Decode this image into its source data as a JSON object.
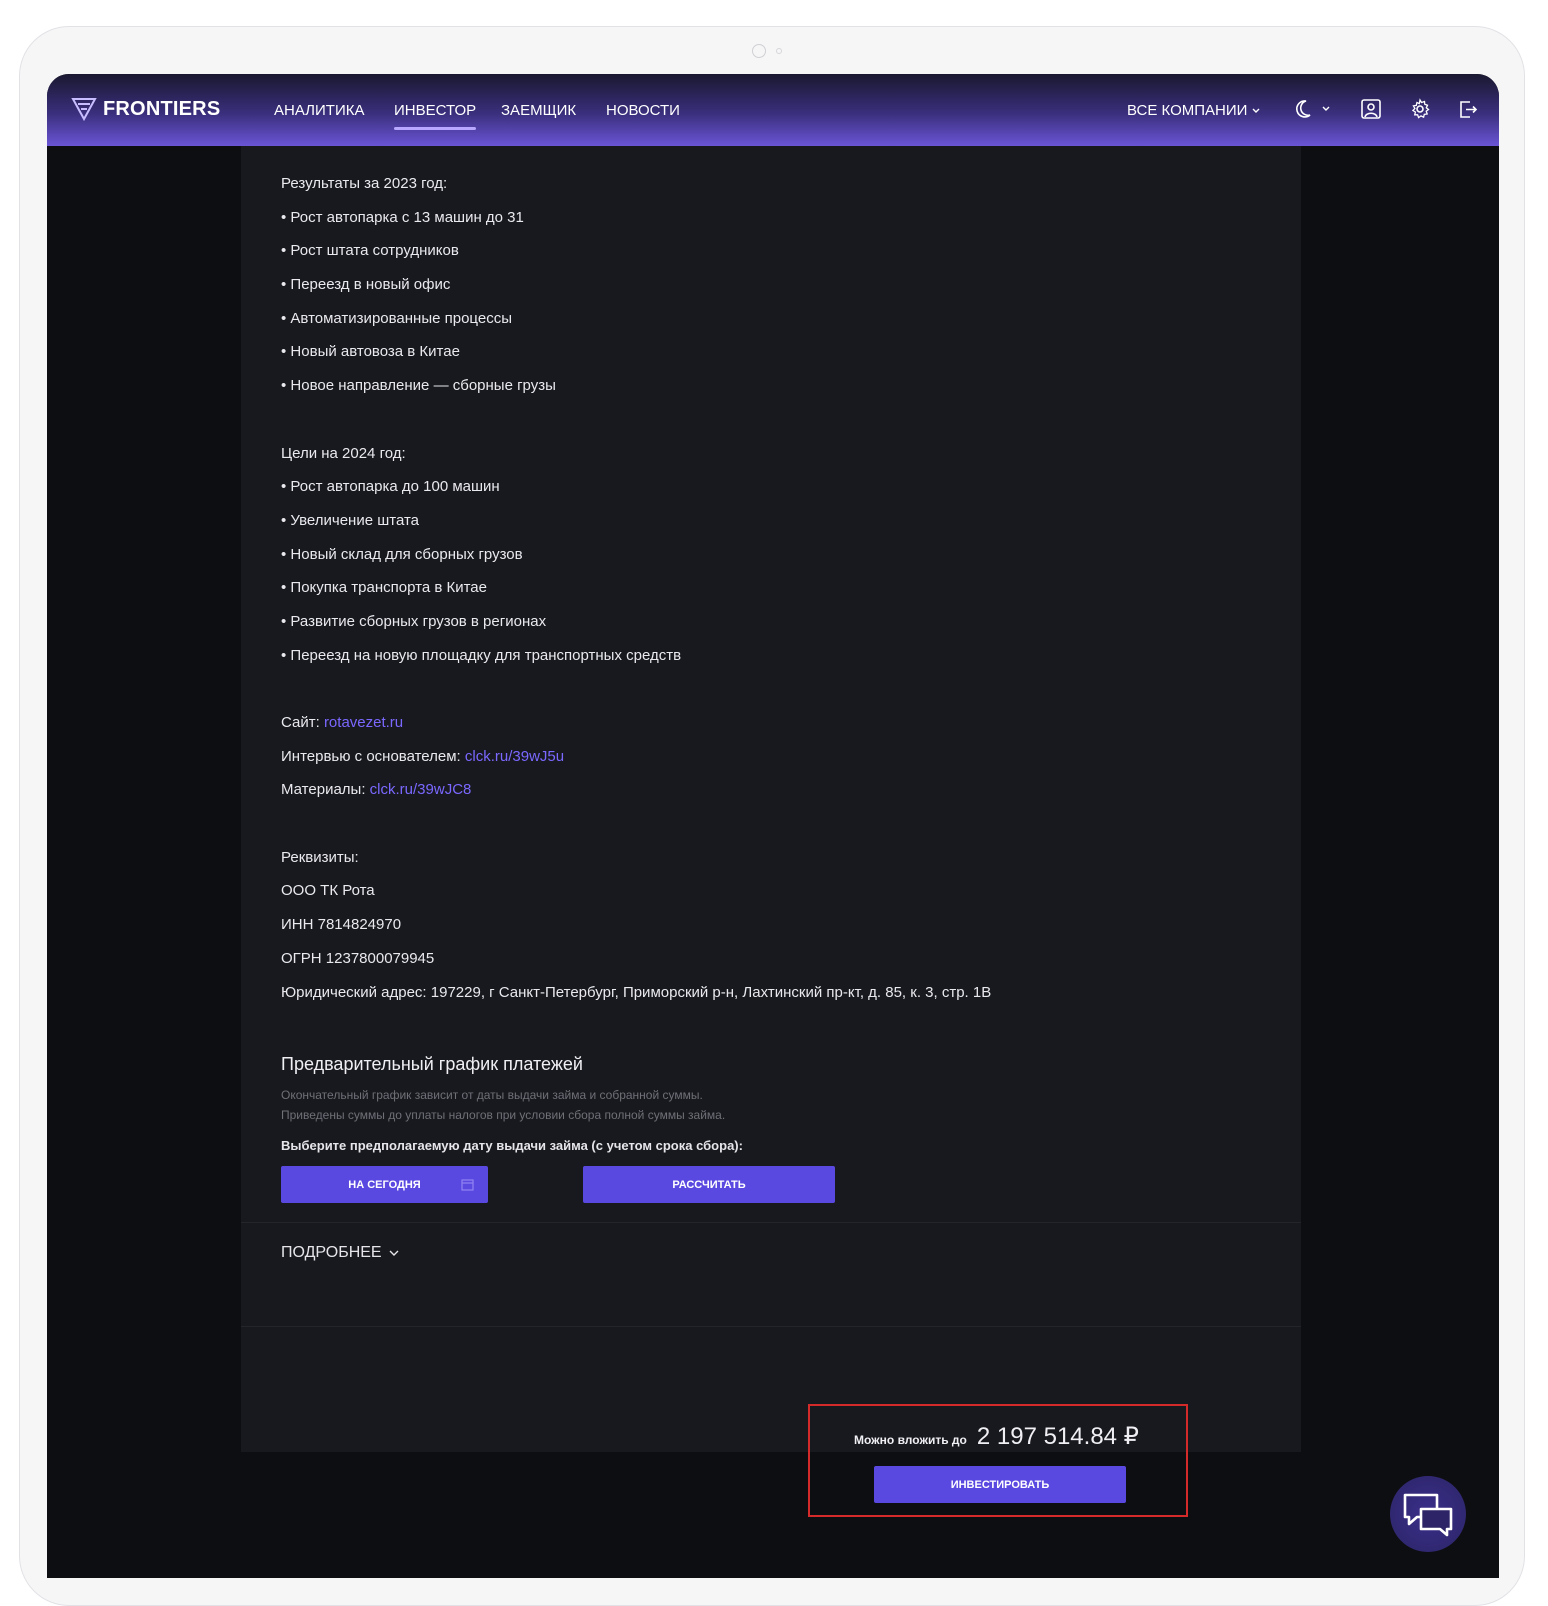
{
  "brand": {
    "name": "FRONTIERS"
  },
  "nav": {
    "items": [
      {
        "label": "АНАЛИТИКА"
      },
      {
        "label": "ИНВЕСТОР"
      },
      {
        "label": "ЗАЕМЩИК"
      },
      {
        "label": "НОВОСТИ"
      }
    ],
    "active": "ИНВЕСТОР",
    "companies_label": "ВСЕ КОМПАНИИ",
    "icons": [
      "moon-icon",
      "chevron-down-icon",
      "profile-icon",
      "gear-icon",
      "logout-icon"
    ]
  },
  "description": {
    "results_title": "Результаты за 2023 год:",
    "results": [
      "• Рост автопарка с 13 машин до 31",
      "• Рост штата сотрудников",
      "• Переезд в новый офис",
      "• Автоматизированные процессы",
      "• Новый автовоза в Китае",
      "• Новое направление — сборные грузы"
    ],
    "goals_title": "Цели на 2024 год:",
    "goals": [
      "• Рост автопарка до 100 машин",
      "• Увеличение штата",
      "• Новый склад для сборных грузов",
      "• Покупка транспорта в Китае",
      "• Развитие сборных грузов в регионах",
      "• Переезд на новую площадку для транспортных средств"
    ],
    "site_label": "Сайт:",
    "site_link": "rotavezet.ru",
    "interview_label": "Интервью с основателем:",
    "interview_link": "clck.ru/39wJ5u",
    "materials_label": "Материалы:",
    "materials_link": "clck.ru/39wJC8",
    "requisites_title": "Реквизиты:",
    "requisites": [
      "ООО ТК Рота",
      "ИНН 7814824970",
      "ОГРН 1237800079945",
      "Юридический адрес: 197229, г Санкт-Петербург, Приморский р-н, Лахтинский пр-кт, д. 85, к. 3, стр. 1В"
    ]
  },
  "schedule": {
    "title": "Предварительный график платежей",
    "note1": "Окончательный график зависит от даты выдачи займа и собранной суммы.",
    "note2": "Приведены суммы до уплаты налогов при условии сбора полной суммы займа.",
    "date_label": "Выберите предполагаемую дату выдачи займа (с учетом срока сбора):",
    "date_button": "НА СЕГОДНЯ",
    "calculate_button": "РАССЧИТАТЬ"
  },
  "more_label": "ПОДРОБНЕЕ",
  "invest": {
    "label": "Можно вложить до",
    "amount": "2 197 514.84 ₽",
    "button": "ИНВЕСТИРОВАТЬ"
  },
  "colors": {
    "accent": "#5a49e0",
    "link": "#7a68ff",
    "panel": "#18191e",
    "highlight_border": "#d42a2a"
  }
}
